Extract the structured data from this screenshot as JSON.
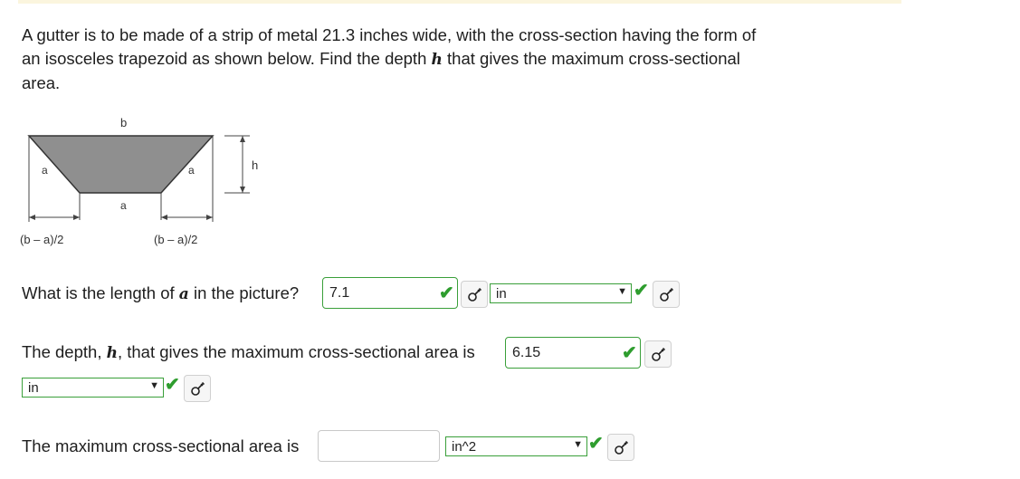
{
  "problem": {
    "line1": "A gutter is to be made of a strip of metal 21.3 inches wide, with the cross-section having the form of",
    "line2_pre": "an isosceles trapezoid as shown below. Find the depth ",
    "line2_var": "h",
    "line2_post": " that gives the maximum cross-sectional",
    "line3": "area."
  },
  "figure": {
    "label_b": "b",
    "label_a_left": "a",
    "label_a_right": "a",
    "label_a_bottom": "a",
    "label_h": "h",
    "label_left_offset": "(b – a)/2",
    "label_right_offset": "(b – a)/2",
    "fill_color": "#8f8f8f"
  },
  "q1": {
    "pre": "What is the length of ",
    "var": "a",
    "post": " in the picture?",
    "value": "7.1",
    "unit": "in"
  },
  "q2": {
    "pre": "The depth, ",
    "var": "h",
    "post": ", that gives the maximum cross-sectional area is",
    "value": "6.15",
    "unit": "in"
  },
  "q3": {
    "text": "The maximum cross-sectional area is",
    "value": "",
    "unit": "in^2"
  },
  "icons": {
    "check": "✔",
    "dropdown": "▼",
    "key": "key-icon"
  },
  "colors": {
    "correct": "#2e9d2e",
    "correct_border": "#3a9f3a",
    "empty_border": "#c9c9c9",
    "top_banner": "#fbf5de"
  }
}
